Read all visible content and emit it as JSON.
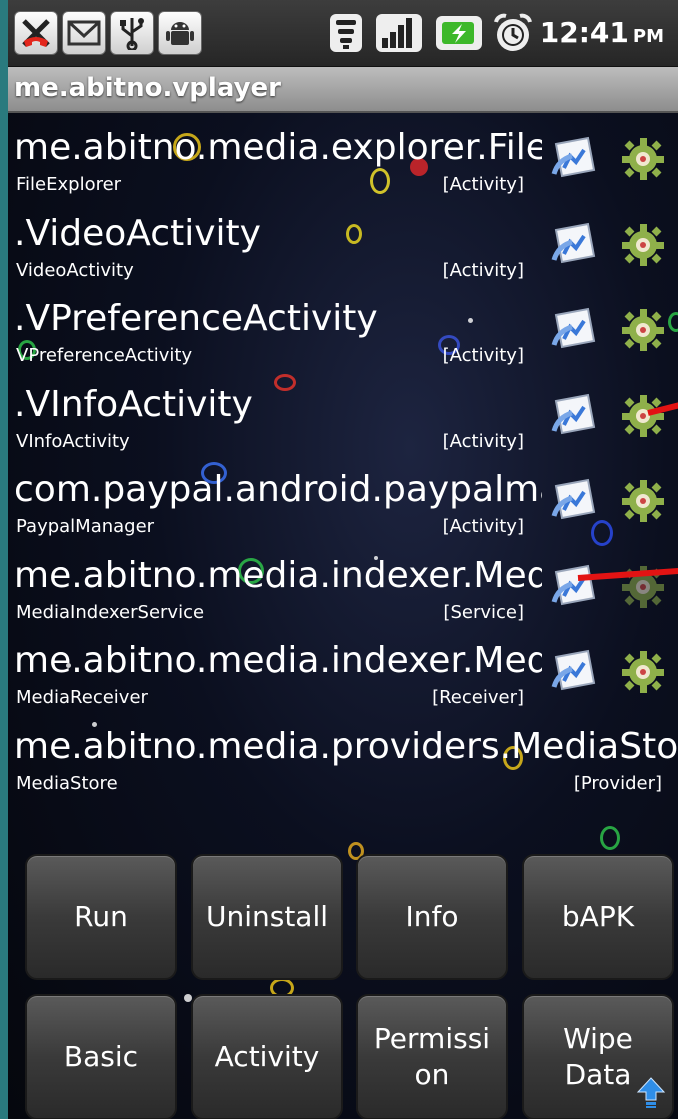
{
  "status_bar": {
    "time": "12:41",
    "ampm": "PM",
    "left_icons": [
      "missed-call-icon",
      "gmail-icon",
      "usb-icon",
      "android-debug-icon"
    ],
    "right_icons": [
      "wifi-icon",
      "signal-icon",
      "battery-charging-icon",
      "alarm-icon"
    ]
  },
  "title": "me.abitno.vplayer",
  "components": [
    {
      "name": "me.abitno.media.explorer.FileExplorer",
      "label": "FileExplorer",
      "kind": "[Activity]"
    },
    {
      "name": ".VideoActivity",
      "label": "VideoActivity",
      "kind": "[Activity]"
    },
    {
      "name": ".VPreferenceActivity",
      "label": "VPreferenceActivity",
      "kind": "[Activity]"
    },
    {
      "name": ".VInfoActivity",
      "label": "VInfoActivity",
      "kind": "[Activity]"
    },
    {
      "name": "com.paypal.android.paypalmanager",
      "label": "PaypalManager",
      "kind": "[Activity]"
    },
    {
      "name": "me.abitno.media.indexer.MediaIndexerService",
      "label": "MediaIndexerService",
      "kind": "[Service]"
    },
    {
      "name": "me.abitno.media.indexer.MediaReceiver",
      "label": "MediaReceiver",
      "kind": "[Receiver]"
    },
    {
      "name": "me.abitno.media.providers.MediaStore",
      "label": "MediaStore",
      "kind": "[Provider]"
    }
  ],
  "row_icons": {
    "launch": "launch-shortcut-icon",
    "settings": "gear-icon"
  },
  "buttons": {
    "run": "Run",
    "uninstall": "Uninstall",
    "info": "Info",
    "bapk": "bAPK",
    "basic": "Basic",
    "activity": "Activity",
    "permission_line1": "Permissi",
    "permission_line2": "on",
    "wipe_line1": "Wipe",
    "wipe_line2": "Data"
  },
  "colors": {
    "annotation_red": "#e31313",
    "wallpaper": "#0b0f1f"
  }
}
